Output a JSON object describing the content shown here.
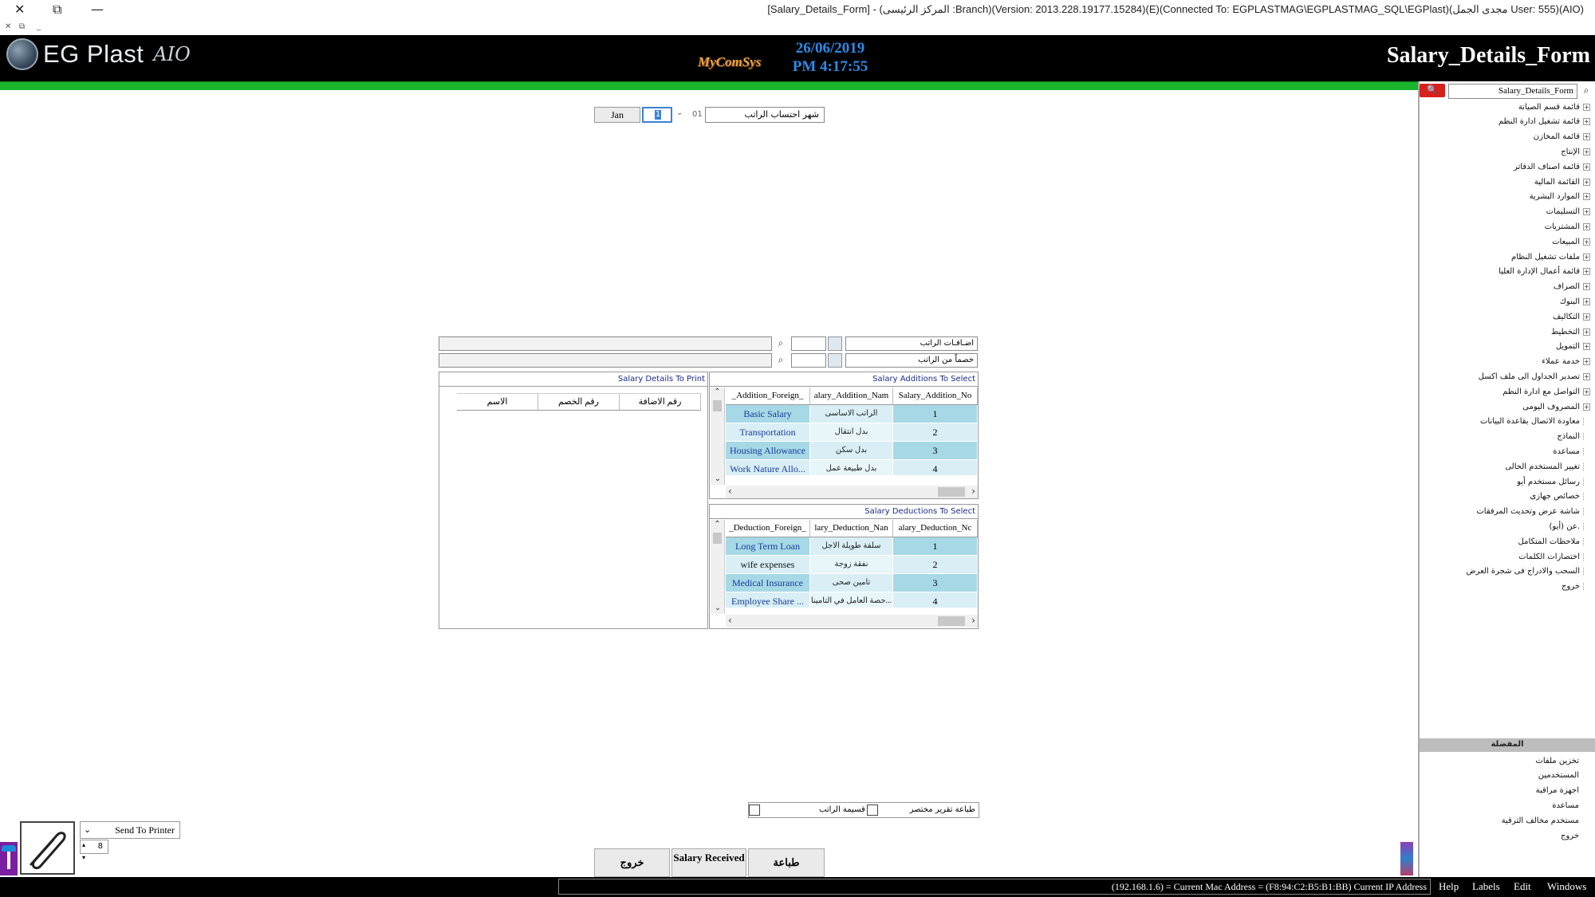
{
  "window": {
    "title": "[Salary_Details_Form] - (المركز الرئيسى :Branch)(Version: 2013.228.19177.15284)(E)(Connected To: EGPLASTMAG\\EGPLASTMAG_SQL\\EGPlast)(مجدى الجمل User: 555)(AIO)",
    "close_glyph": "✕",
    "restore_glyph": "⧉",
    "minimize_glyph": "—",
    "mini_close": "✕",
    "mini_restore": "⧉",
    "mini_min": "_"
  },
  "header": {
    "logo_text": "EG Plast",
    "logo_aio": "AIO",
    "brand": "MyComSys",
    "date": "26/06/2019",
    "time": "PM 4:17:55",
    "form_name": "Salary_Details_Form"
  },
  "month": {
    "label": "شهر احتساب الراتب",
    "number": "01",
    "chevron": "⌄",
    "spin_value": "1",
    "button": "Jan"
  },
  "filters": {
    "additions_label": "اضـافـات الراتب",
    "deductions_label": "خصماً من الراتب",
    "search_glyph": "⌕"
  },
  "additions": {
    "title": "Salary Additions To Select",
    "headers": [
      "Salary_Addition_No",
      "Salary_Addition_Name",
      "Salary_Addition_Foreign_Name"
    ],
    "header_display": [
      "Salary_Addition_No",
      "alary_Addition_Nam",
      "_Addition_Foreign_"
    ],
    "rows": [
      {
        "no": "1",
        "name": "الراتب الاساسى",
        "foreign": "Basic Salary"
      },
      {
        "no": "2",
        "name": "بدل انتقال",
        "foreign": "Transportation"
      },
      {
        "no": "3",
        "name": "بدل سكن",
        "foreign": "Housing Allowance"
      },
      {
        "no": "4",
        "name": "بدل طبيعة عمل",
        "foreign": "Work Nature Allo..."
      }
    ]
  },
  "deductions": {
    "title": "Salary Deductions To Select",
    "header_display": [
      "alary_Deduction_Nc",
      "lary_Deduction_Nan",
      "_Deduction_Foreign_"
    ],
    "rows": [
      {
        "no": "1",
        "name": "سلفة طويلة الاجل",
        "foreign": "Long Term Loan"
      },
      {
        "no": "2",
        "name": "نفقة زوجة",
        "foreign": "wife expenses"
      },
      {
        "no": "3",
        "name": "تامين صحى",
        "foreign": "Medical Insurance"
      },
      {
        "no": "4",
        "name": "حصة العامل في التامينا...",
        "foreign": "Employee Share ..."
      }
    ]
  },
  "print_panel": {
    "title": "Salary Details To Print",
    "headers": [
      "رقم الاضافة",
      "رقم الخصم",
      "الاسم"
    ]
  },
  "tree": {
    "search_value": "Salary_Details_Form",
    "items": [
      "قائمة قسم الصيانة",
      "قائمة تشغيل ادارة النظم",
      "قائمة المخازن",
      "الإنتاج",
      "قائمة اصناف الدفاتر",
      "القائمة المالية",
      "الموارد البشرية",
      "التسليمات",
      "المشتريات",
      "المبيعات",
      "ملفات تشغيل النظام",
      "قائمة أعمال الإدارة العليا",
      "الصراف",
      "البنوك",
      "التكاليف",
      "التخطيط",
      "التمويل",
      "خدمة عملاء",
      "تصدير الجداول الى ملف اكسل",
      "التواصل مع ادارة النظم",
      "المصروف اليومى",
      "معاودة الاتصال بقاعدة البيانات",
      "النماذج",
      "مساعدة",
      "تغيير المستخدم الحالى",
      "رسائل مستخدم أيو",
      "خصائص جهازى",
      "شاشة عرض وتحديث المرفقات",
      "عن (أيو).",
      "ملاحظات المتكامل",
      "اختصارات الكلمات",
      "السحب والادراج فى شجرة العرض",
      "خروج"
    ],
    "expandable_count": 21
  },
  "favorites": {
    "header": "المفضلة",
    "items": [
      "تخزين ملفات",
      "المستخدمين",
      "اجهزة مراقبة",
      "مساعدة",
      "مستخدم مخالف الترقية",
      "خروج"
    ]
  },
  "options": {
    "summary_report": "طباعة تقرير مختصر",
    "payslip": "قسيمة الراتب"
  },
  "buttons": {
    "print": "طباعة",
    "salary_received": "Salary Received",
    "exit": "خروج"
  },
  "bottom_left": {
    "printer": "Send To Printer",
    "copies": "8"
  },
  "status": {
    "mac": "(192.168.1.6) = Current Mac Address = (F8:94:C2:B5:B1:BB) Current IP Address",
    "menus": [
      "Help",
      "Labels",
      "Edit",
      "Windows"
    ]
  },
  "colors": {
    "header_bg": "#000000",
    "green_bar": "#19b52b",
    "row_blue": "#a7d8e6",
    "row_light": "#d9eff5",
    "accent_red": "#d8201c",
    "date_blue": "#2b8ae8"
  }
}
